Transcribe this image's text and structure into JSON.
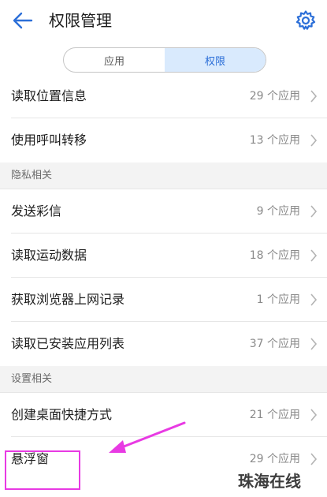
{
  "header": {
    "title": "权限管理",
    "back_icon": "back-arrow-icon",
    "settings_icon": "gear-icon"
  },
  "segmented": {
    "tabs": [
      {
        "label": "应用",
        "active": false
      },
      {
        "label": "权限",
        "active": true
      }
    ]
  },
  "groups": [
    {
      "title": "",
      "items": [
        {
          "label": "读取位置信息",
          "count": "29 个应用"
        },
        {
          "label": "使用呼叫转移",
          "count": "13 个应用"
        }
      ]
    },
    {
      "title": "隐私相关",
      "items": [
        {
          "label": "发送彩信",
          "count": "9 个应用"
        },
        {
          "label": "读取运动数据",
          "count": "18 个应用"
        },
        {
          "label": "获取浏览器上网记录",
          "count": "1 个应用"
        },
        {
          "label": "读取已安装应用列表",
          "count": "37 个应用"
        }
      ]
    },
    {
      "title": "设置相关",
      "items": [
        {
          "label": "创建桌面快捷方式",
          "count": "21 个应用"
        },
        {
          "label": "悬浮窗",
          "count": "29 个应用"
        }
      ]
    }
  ],
  "colors": {
    "accent": "#2c6fd8",
    "segment_active_bg": "#d9eafd",
    "annotation": "#e83ae3"
  },
  "watermark": "珠海在线"
}
